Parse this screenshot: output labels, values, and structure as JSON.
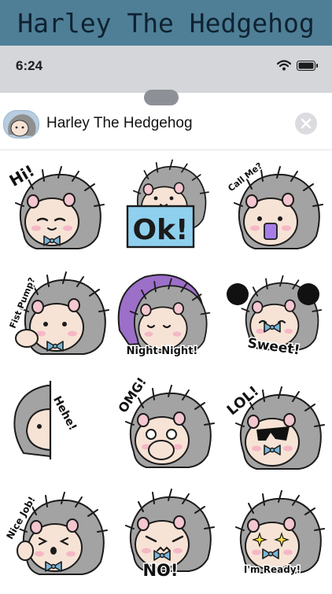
{
  "banner": {
    "title": "Harley The Hedgehog"
  },
  "status_bar": {
    "time": "6:24",
    "icons": [
      "wifi-icon",
      "battery-icon"
    ]
  },
  "sheet": {
    "pack_title": "Harley The Hedgehog",
    "close_icon": "close-icon",
    "pack_icon": "hedgehog-avatar-icon"
  },
  "stickers": [
    {
      "caption": "Hi!",
      "pose": "happy-wave"
    },
    {
      "caption": "Ok!",
      "pose": "holding-sign"
    },
    {
      "caption": "Call Me?",
      "pose": "holding-phone"
    },
    {
      "caption": "Fist Pump?",
      "pose": "fist-bump"
    },
    {
      "caption": "Night Night!",
      "pose": "sleeping-blanket"
    },
    {
      "caption": "Sweet!",
      "pose": "pom-poms"
    },
    {
      "caption": "Hehe!",
      "pose": "peeking"
    },
    {
      "caption": "OMG!",
      "pose": "hands-on-mouth"
    },
    {
      "caption": "LOL!",
      "pose": "sunglasses-laughing"
    },
    {
      "caption": "Nice Job!",
      "pose": "thumbs-up"
    },
    {
      "caption": "NO!",
      "pose": "angry"
    },
    {
      "caption": "I'm Ready!",
      "pose": "sparkle-eyes"
    }
  ],
  "colors": {
    "banner_bg": "#4f7f96",
    "status_bg": "#d5d6da",
    "hedgehog_skin": "#f7e3d5",
    "quills": "#9a9a9a",
    "bowtie": "#7bb6d6",
    "ok_sign": "#8fd0ee",
    "blanket": "#9c6fc9"
  }
}
